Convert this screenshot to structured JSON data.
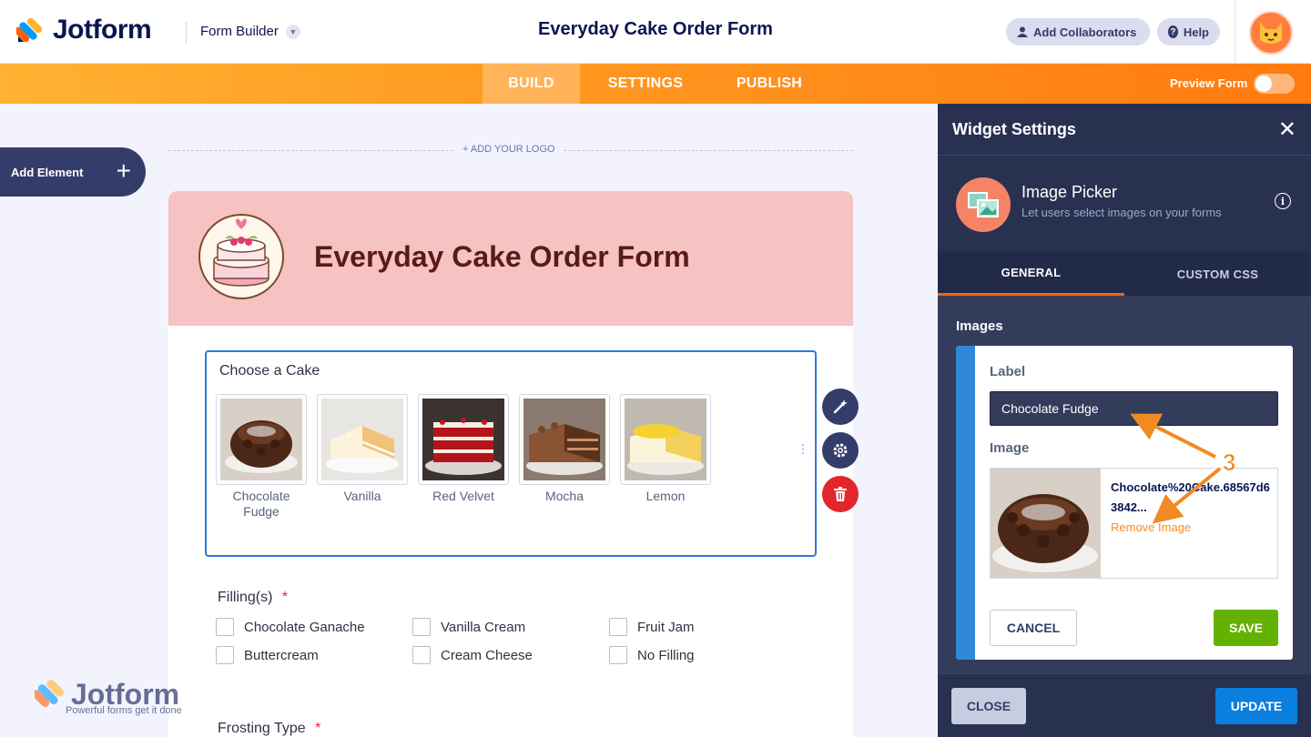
{
  "app": {
    "logo_text": "Jotform",
    "builder_label": "Form Builder",
    "form_title": "Everyday Cake Order Form"
  },
  "header_actions": {
    "collaborators_label": "Add Collaborators",
    "help_label": "Help"
  },
  "nav": {
    "tabs": [
      {
        "label": "BUILD",
        "active": true
      },
      {
        "label": "SETTINGS",
        "active": false
      },
      {
        "label": "PUBLISH",
        "active": false
      }
    ],
    "preview_label": "Preview Form",
    "preview_enabled": false
  },
  "sidebar": {
    "add_element_label": "Add Element"
  },
  "canvas": {
    "add_logo_label": "+ ADD YOUR LOGO"
  },
  "form": {
    "title": "Everyday Cake Order Form",
    "q_cake": {
      "label": "Choose a Cake",
      "options": [
        {
          "label": "Chocolate Fudge"
        },
        {
          "label": "Vanilla"
        },
        {
          "label": "Red Velvet"
        },
        {
          "label": "Mocha"
        },
        {
          "label": "Lemon"
        }
      ]
    },
    "q_filling": {
      "label": "Filling(s)",
      "required_mark": "*",
      "options": [
        "Chocolate Ganache",
        "Vanilla Cream",
        "Fruit Jam",
        "Buttercream",
        "Cream Cheese",
        "No Filling"
      ]
    },
    "q_frosting": {
      "label": "Frosting Type",
      "required_mark": "*"
    }
  },
  "watermark": {
    "text": "Jotform",
    "tagline": "Powerful forms get it done"
  },
  "panel": {
    "title": "Widget Settings",
    "widget_name": "Image Picker",
    "widget_desc": "Let users select images on your forms",
    "info_glyph": "i",
    "tabs": [
      {
        "label": "GENERAL",
        "active": true
      },
      {
        "label": "CUSTOM CSS",
        "active": false
      }
    ],
    "images_heading": "Images",
    "label_heading": "Label",
    "label_value": "Chocolate Fudge",
    "image_heading": "Image",
    "image_filename": "Chocolate%20Cake.68567d63842...",
    "remove_label": "Remove Image",
    "cancel_label": "CANCEL",
    "save_label": "SAVE",
    "close_label": "CLOSE",
    "update_label": "UPDATE"
  },
  "annotation": {
    "step_number": "3"
  },
  "colors": {
    "accent_orange": "#ff7a10",
    "navy": "#0a1551",
    "panel_bg": "#293151",
    "save_green": "#64b200",
    "update_blue": "#0b7fe0",
    "header_pink": "#f6c2c2"
  }
}
